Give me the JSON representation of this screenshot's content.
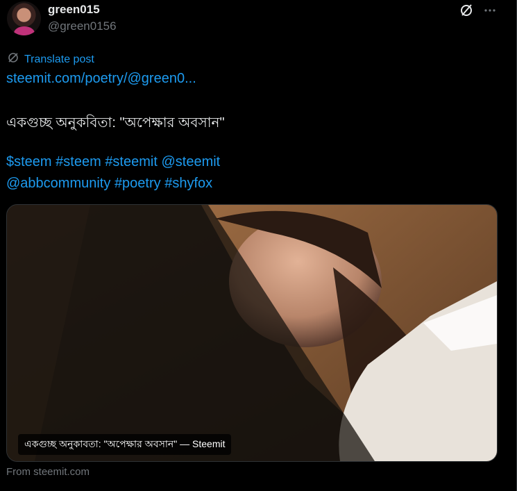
{
  "user": {
    "display_name": "green015",
    "handle": "@green0156"
  },
  "actions": {
    "grok_icon": "slash-circle-icon",
    "more_icon": "ellipsis-icon"
  },
  "translate": {
    "label": "Translate post",
    "icon": "translate-icon"
  },
  "post": {
    "link_text": "steemit.com/poetry/@green0...",
    "title": "একগুচ্ছ অনুকবিতা: \"অপেক্ষার অবসান\"",
    "tags_line1": [
      "$steem",
      "#steem",
      "#steemit",
      "@steemit"
    ],
    "tags_line2": [
      "@abbcommunity",
      "#poetry",
      "#shyfox"
    ]
  },
  "card": {
    "caption": "একগুচ্ছ অনুকাবতা: \"অপেক্ষার অবসান\" — Steemit",
    "source": "From steemit.com"
  },
  "colors": {
    "accent": "#1d9bf0",
    "text": "#e7e9ea",
    "muted": "#71767b",
    "background": "#000000"
  }
}
